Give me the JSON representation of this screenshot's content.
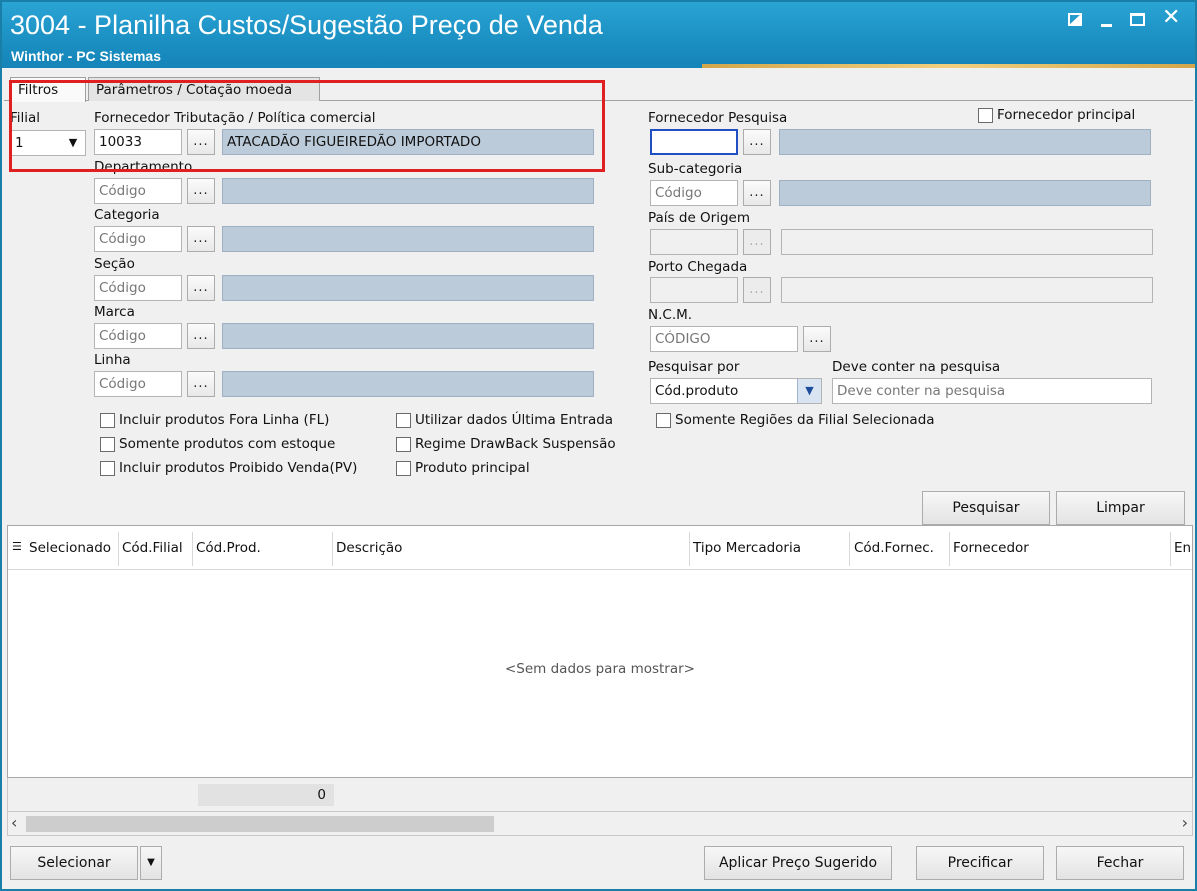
{
  "window": {
    "title": "3004 - Planilha Custos/Sugestão Preço de Venda",
    "subtitle": "Winthor - PC Sistemas",
    "close_glyph": "✕"
  },
  "tabs": [
    {
      "label": "Filtros"
    },
    {
      "label": "Parâmetros / Cotação moeda"
    }
  ],
  "left": {
    "filial_label": "Filial",
    "filial_value": "1",
    "fornecedor_label": "Fornecedor Tributação / Política comercial",
    "fornecedor_code": "10033",
    "fornecedor_desc": "ATACADÃO FIGUEIREDÃO IMPORTADO",
    "departamento_label": "Departamento",
    "categoria_label": "Categoria",
    "secao_label": "Seção",
    "marca_label": "Marca",
    "linha_label": "Linha",
    "code_placeholder": "Código",
    "dots": "..."
  },
  "right": {
    "fornecedor_pesquisa_label": "Fornecedor Pesquisa",
    "fornecedor_principal_label": "Fornecedor principal",
    "subcategoria_label": "Sub-categoria",
    "pais_label": "País de Origem",
    "porto_label": "Porto Chegada",
    "ncm_label": "N.C.M.",
    "ncm_placeholder": "CÓDIGO",
    "pesquisar_por_label": "Pesquisar por",
    "pesquisar_por_value": "Cód.produto",
    "deve_conter_label": "Deve conter na pesquisa",
    "deve_conter_placeholder": "Deve conter na pesquisa",
    "somente_regioes_label": "Somente Regiões da Filial Selecionada"
  },
  "checkboxes": {
    "fora_linha": "Incluir produtos Fora Linha (FL)",
    "com_estoque": "Somente produtos com estoque",
    "proibido_venda": "Incluir produtos Proibido Venda(PV)",
    "ultima_entrada": "Utilizar dados Última Entrada",
    "drawback": "Regime DrawBack Suspensão",
    "produto_principal": "Produto principal"
  },
  "actions": {
    "pesquisar": "Pesquisar",
    "limpar": "Limpar",
    "selecionar": "Selecionar",
    "aplicar": "Aplicar Preço Sugerido",
    "precificar": "Precificar",
    "fechar": "Fechar"
  },
  "grid": {
    "columns": [
      "Selecionado",
      "Cód.Filial",
      "Cód.Prod.",
      "Descrição",
      "Tipo Mercadoria",
      "Cód.Fornec.",
      "Fornecedor",
      "En"
    ],
    "empty_message": "<Sem dados para mostrar>",
    "footer_total": "0"
  }
}
